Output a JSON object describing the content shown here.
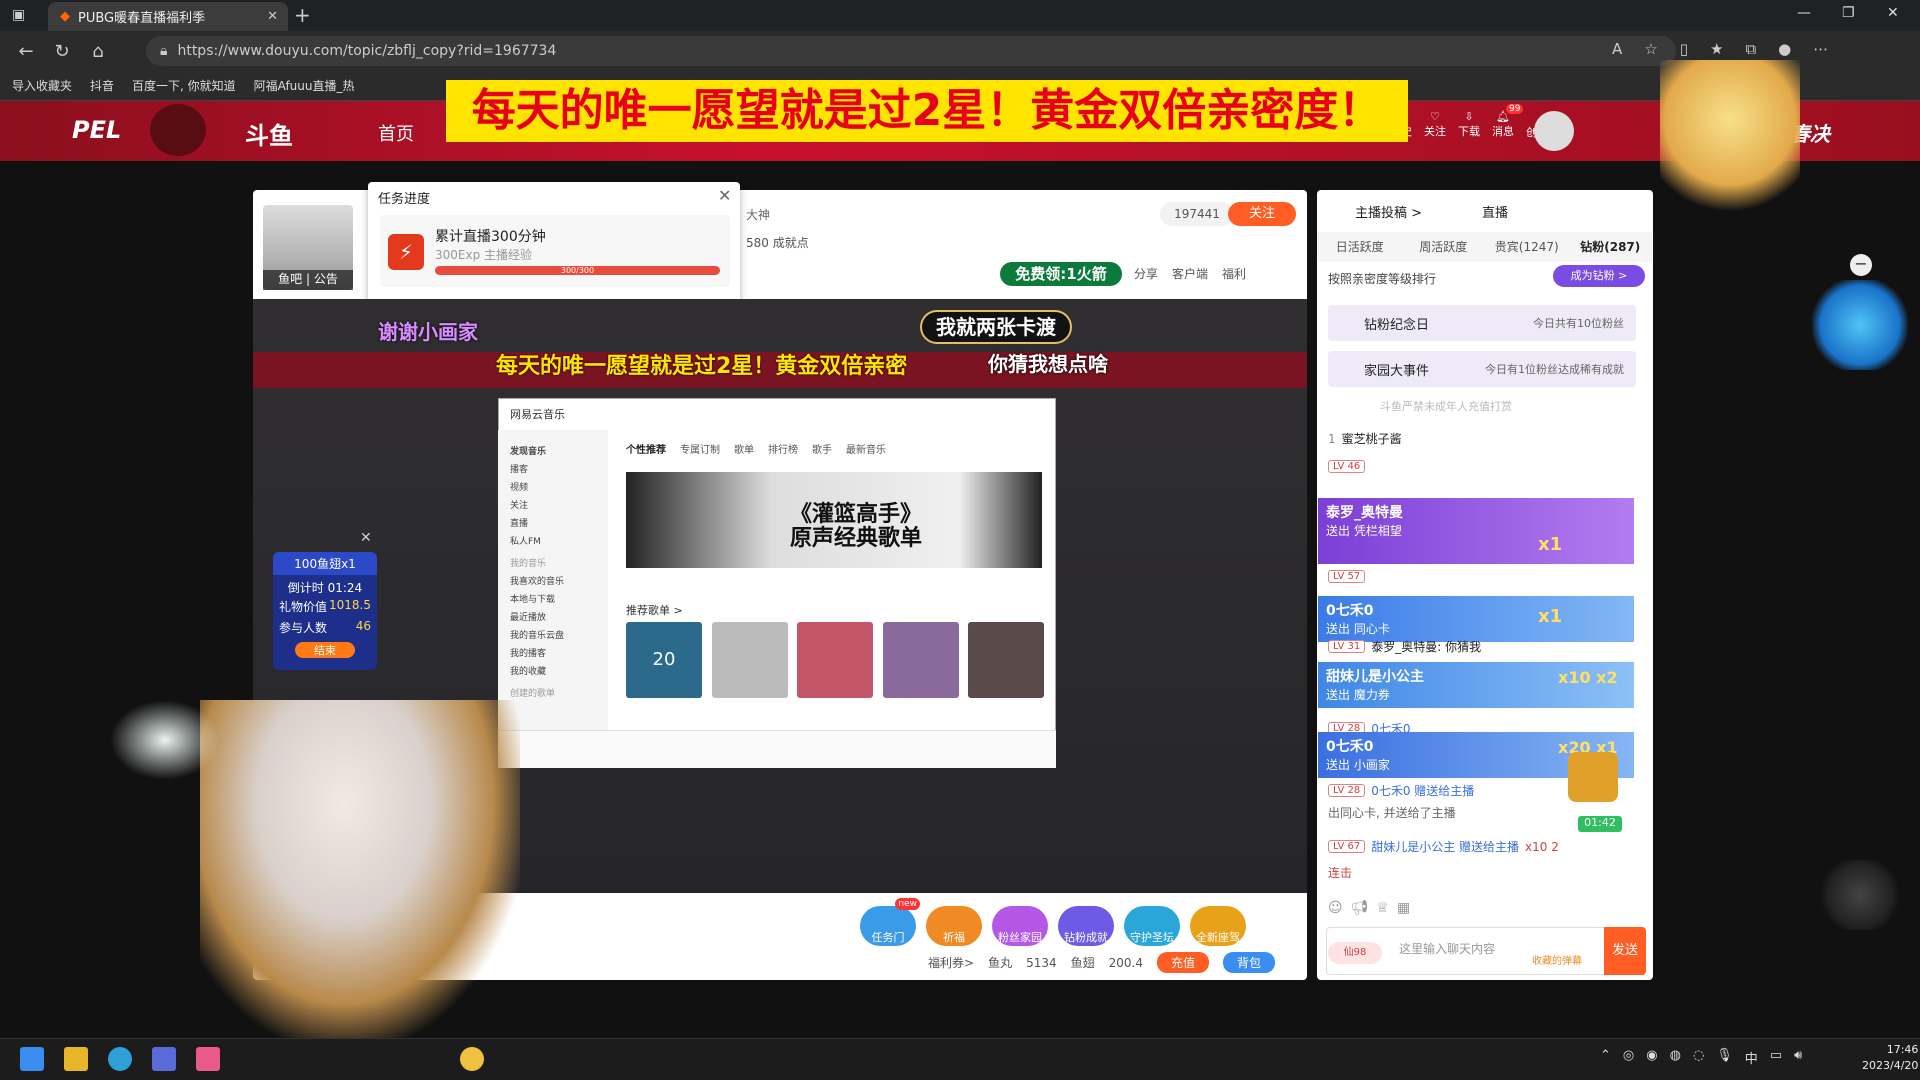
{
  "browser": {
    "tab_title": "PUBG暖春直播福利季",
    "url": "https://www.douyu.com/topic/zbflj_copy?rid=1967734",
    "favorites": [
      "导入收藏夹",
      "抖音",
      "百度一下, 你就知道",
      "阿福Afuuu直播_热"
    ]
  },
  "site": {
    "pel": "PEL",
    "logo": "斗鱼",
    "home": "首页",
    "header_tools": [
      "历史",
      "关注",
      "下载",
      "消息",
      "创作中心"
    ],
    "msg_badge": "99",
    "spring": "春决"
  },
  "banner": "每天的唯一愿望就是过2星！黄金双倍亲密度！",
  "task": {
    "title": "任务进度",
    "label": "累计直播300分钟",
    "exp": "300Exp 主播经验",
    "progress_text": "300/300",
    "progress": 1.0
  },
  "room": {
    "yuba": "鱼吧 | 公告",
    "dashen": "大神",
    "achieve": "580 成就点",
    "follow_count": "197441",
    "follow": "关注",
    "free_gift": "免费领:1火箭",
    "actions": [
      "分享",
      "客户端",
      "福利"
    ]
  },
  "video": {
    "banner": "每天的唯一愿望就是过2星！黄金双倍亲密",
    "guess": "你猜我想点啥",
    "bubble1": "谢谢小画家",
    "bubble2": "我就两张卡渡",
    "netease": {
      "title": "网易云音乐",
      "sidebar": [
        "发现音乐",
        "播客",
        "视频",
        "关注",
        "直播",
        "私人FM",
        "我的音乐",
        "我喜欢的音乐",
        "本地与下载",
        "最近播放",
        "我的音乐云盘",
        "我的播客",
        "我的收藏",
        "创建的歌单"
      ],
      "tabs": [
        "个性推荐",
        "专属订制",
        "歌单",
        "排行榜",
        "歌手",
        "最新音乐"
      ],
      "banner_title": "《灌篮高手》",
      "banner_sub": "原声经典歌单",
      "heading": "推荐歌单 >",
      "card_day": "20"
    }
  },
  "lottery": {
    "title": "100鱼翅x1",
    "countdown": "倒计时 01:24",
    "gift_label": "礼物价值",
    "gift_value": "1018.5",
    "people_label": "参与人数",
    "people_value": "46",
    "end": "结束"
  },
  "gifts": [
    {
      "label": "任务门",
      "badge": "new",
      "color": "#3a9be8"
    },
    {
      "label": "祈福",
      "color": "#f08a24"
    },
    {
      "label": "粉丝家园",
      "color": "#b457e6"
    },
    {
      "label": "钻粉成就",
      "color": "#6d5be6"
    },
    {
      "label": "守护圣坛",
      "color": "#2aa7d8"
    },
    {
      "label": "全新座驾",
      "color": "#e8a21a"
    }
  ],
  "wallet": {
    "coupon": "福利券>",
    "fishball_label": "鱼丸",
    "fishball": "5134",
    "fishfin_label": "鱼翅",
    "fishfin": "200.4",
    "recharge": "充值",
    "bag": "背包"
  },
  "chat": {
    "top_left": "主播投稿 >",
    "top_right": "直播",
    "tabs": [
      "日活跃度",
      "周活跃度",
      "贵宾(1247)",
      "钻粉(287)"
    ],
    "rank_hint": "按照亲密度等级排行",
    "become_fan": "成为钻粉 >",
    "notice1": {
      "title": "钻粉纪念日",
      "sub": "今日共有10位粉丝"
    },
    "notice2": {
      "title": "家园大事件",
      "sub": "今日有1位粉丝达成稀有成就"
    },
    "protect": "斗鱼严禁未成年人充值打赏",
    "first_row": "蜜芝桃子酱",
    "banners": [
      {
        "name": "泰罗_奥特曼",
        "gift": "送出 凭栏相望",
        "count": "x1",
        "color": "#7b3fd6"
      },
      {
        "name": "0七禾0",
        "gift": "送出 同心卡",
        "count": "x1",
        "color": "#3b7be8"
      },
      {
        "name": "甜妹儿是小公主",
        "gift": "送出 魔力券",
        "count": "x10 x2",
        "color": "#3f86e6"
      },
      {
        "name": "0七禾0",
        "gift": "送出 小画家",
        "count": "x20 x1",
        "color": "#3a6fe0"
      }
    ],
    "rows": [
      {
        "lv": "LV 46"
      },
      {
        "lv": "LV 57"
      },
      {
        "lv": "LV 31",
        "text": "泰罗_奥特曼: 你猜我"
      },
      {
        "lv": "LV 28",
        "text": "0七禾0"
      },
      {
        "lv": "LV 28",
        "text": "0七禾0 赠送给主播",
        "extra": "出同心卡, 并送给了主播"
      },
      {
        "lv": "LV 67",
        "text": "甜妹儿是小公主 赠送给主播",
        "extra": "x10 2",
        "more": "连击"
      }
    ],
    "timer": "01:42",
    "input_placeholder": "这里输入聊天内容",
    "count": "仙98",
    "favorite": "收藏的弹幕",
    "send": "发送"
  },
  "taskbar": {
    "time": "17:46",
    "date": "2023/4/20",
    "ime": "中"
  }
}
